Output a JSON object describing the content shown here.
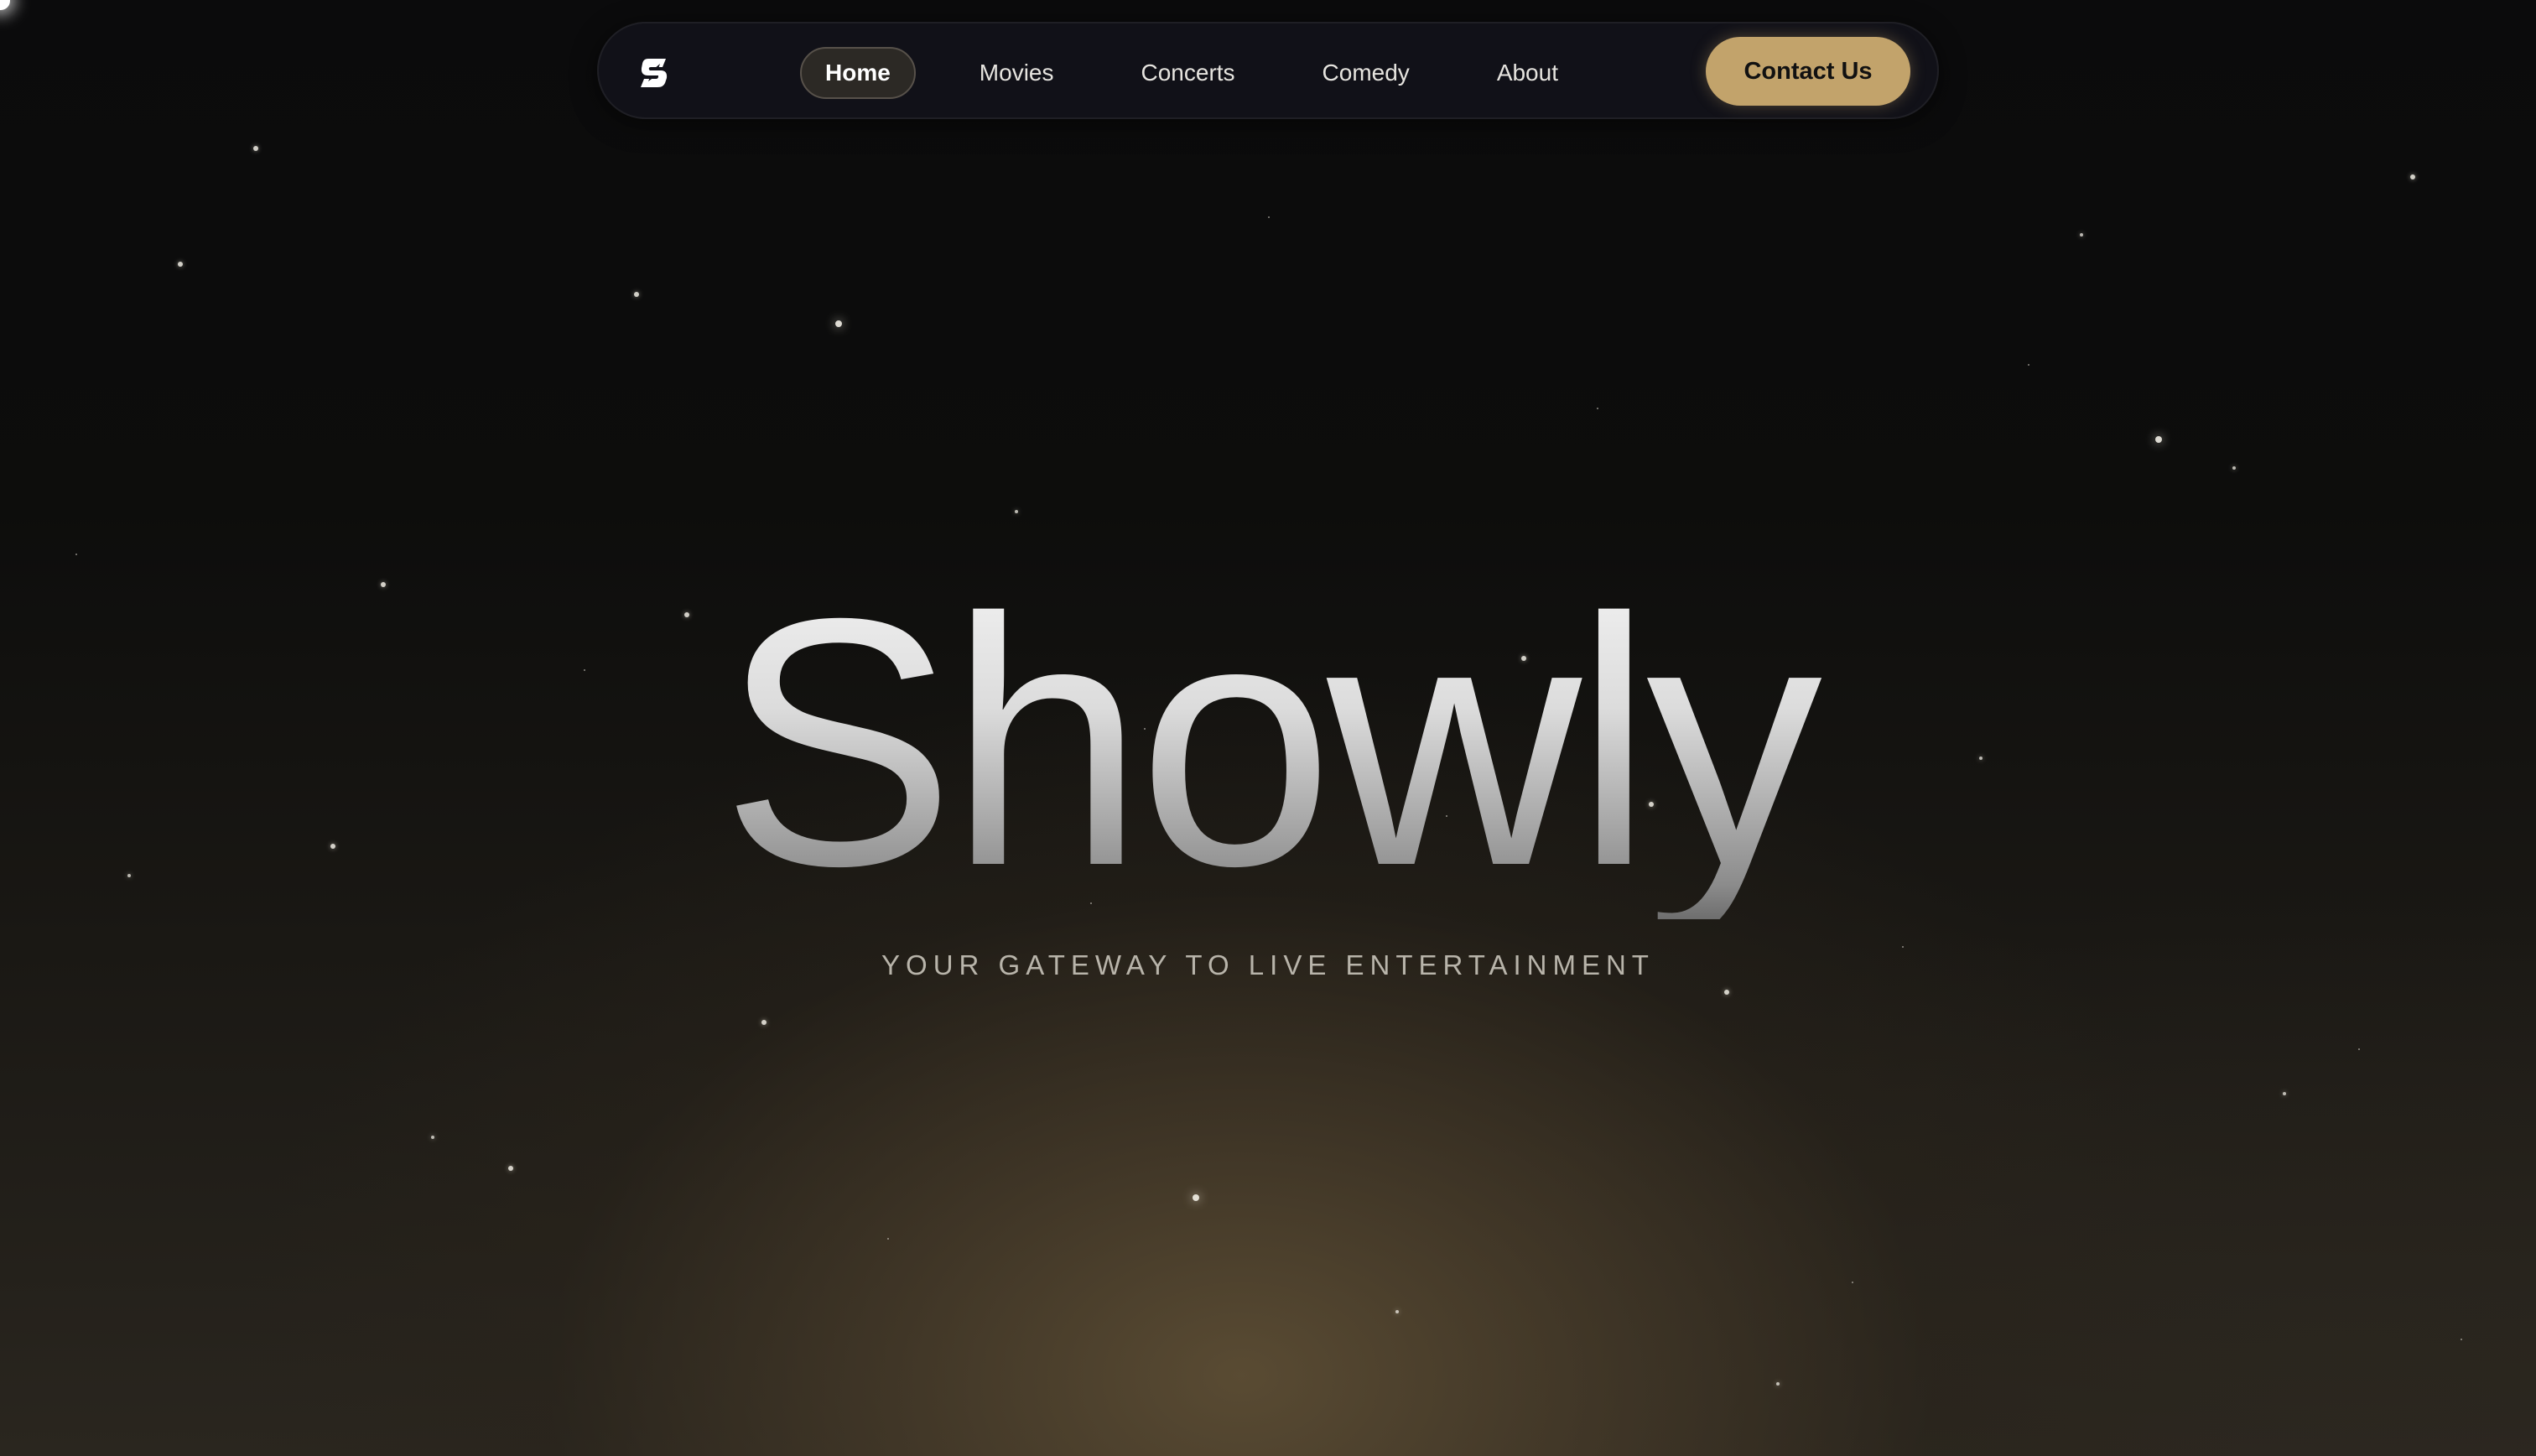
{
  "brand": {
    "logo_icon": "showly-s-logo-icon",
    "name": "Showly"
  },
  "nav": {
    "items": [
      {
        "label": "Home",
        "active": true
      },
      {
        "label": "Movies",
        "active": false
      },
      {
        "label": "Concerts",
        "active": false
      },
      {
        "label": "Comedy",
        "active": false
      },
      {
        "label": "About",
        "active": false
      }
    ],
    "cta_label": "Contact Us"
  },
  "hero": {
    "title": "Showly",
    "subtitle": "YOUR GATEWAY TO LIVE ENTERTAINMENT"
  },
  "colors": {
    "accent": "#c2a36b",
    "background": "#0a0a0a",
    "nav_background": "#12121a",
    "glow": "#5c4d34"
  }
}
